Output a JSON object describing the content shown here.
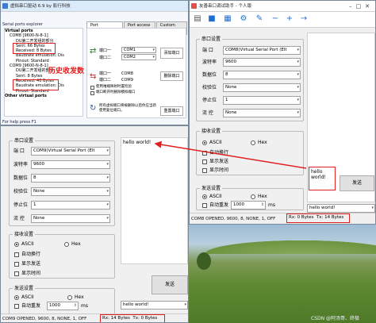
{
  "colors": {
    "accent_red": "#e02020",
    "vspd_title_blue": "#dcebfa",
    "assistant_icon_blue": "#1f6fd1",
    "status_bg": "#f0f0f0",
    "grass_green": "#6f9a3f",
    "sky_blue": "#8fb8d8",
    "callout_bg": "#ffffe0"
  },
  "vspd": {
    "title": "虚拟串口驱动 6.9 by 影行科技",
    "menu": [
      "Port management",
      "Port access list",
      "Custom pinout"
    ],
    "explorer_title": "Serial ports explorer",
    "tree": [
      "Virtual ports",
      "COM8 [9600-N-8-1]",
      "DU第二开发组的部分",
      "Sent: 66 Bytes",
      "Received: 8 Bytes",
      "Baudrate emulation: Dis",
      "Pinout: Standard",
      "COM9 [9600-N-8-1]",
      "DU第二开发组的部分",
      "Sent: 8 Bytes",
      "Received: 40 Bytes",
      "Baudrate emulation: Dis",
      "Pinout: Standard",
      "Other virtual ports"
    ],
    "port1_label": "端口一",
    "port1_value": "COM1",
    "port2_label": "端口二",
    "port2_value": "COM2",
    "add_button": "添加端口",
    "del_port1_label": "端口一",
    "del_port1_value": "COM8",
    "del_port2_label": "端口二",
    "del_port2_value": "COM9",
    "delete_button": "删除端口",
    "chk1": "使用唯端映射时置检验",
    "chk2": "端口断开时删除模拟端口",
    "reset_text": "所有虚拟端口将被删除以后你应当新使用复位端口。",
    "reset_button": "重置端口",
    "status": "For help press F1",
    "annotation": "历史收发数"
  },
  "assistant_top": {
    "title": "友善串口调试助手 - 个人版",
    "settings_title": "串口设置",
    "port_label": "端 口",
    "port_value": "COM8(Virtual Serial Port (Elt",
    "baud_label": "波特率",
    "baud_value": "9600",
    "data_label": "数据位",
    "data_value": "8",
    "parity_label": "校验位",
    "parity_value": "None",
    "stop_label": "停止位",
    "stop_value": "1",
    "flow_label": "流 控",
    "flow_value": "None",
    "rx_title": "接收设置",
    "rx_ascii": "ASCII",
    "rx_hex": "Hex",
    "rx_opts": [
      "自动换行",
      "显示发送",
      "显示时间"
    ],
    "tx_title": "发送设置",
    "tx_ascii": "ASCII",
    "tx_hex": "Hex",
    "repeat_label": "自动重发",
    "repeat_value": "1000",
    "repeat_unit": "ms",
    "callout": "hello\nworld!",
    "send_button": "发送",
    "tx_input": "hello world!",
    "status": "COM8 OPENED, 9600, 8, NONE, 1, OFF",
    "rx_count": "Rx: 0 Bytes",
    "tx_count": "Tx: 14 Bytes"
  },
  "assistant_bottom": {
    "settings_title": "串口设置",
    "port_label": "端 口",
    "port_value": "COM9(Virtual Serial Port (Elt",
    "baud_label": "波特率",
    "baud_value": "9600",
    "data_label": "数据位",
    "data_value": "8",
    "parity_label": "校验位",
    "parity_value": "None",
    "stop_label": "停止位",
    "stop_value": "1",
    "flow_label": "流 控",
    "flow_value": "None",
    "rx_area": "hello world!",
    "rx_title": "接收设置",
    "rx_ascii": "ASCII",
    "rx_hex": "Hex",
    "rx_opts": [
      "自动换行",
      "显示发送",
      "显示时间"
    ],
    "tx_title": "发送设置",
    "tx_ascii": "ASCII",
    "tx_hex": "Hex",
    "repeat_label": "自动重发",
    "repeat_value": "1000",
    "repeat_unit": "ms",
    "send_button": "发送",
    "tx_input": "hello world!",
    "status": "COM9 OPENED, 9600, 8, NONE, 1, OFF",
    "rx_count": "Rx: 14 Bytes",
    "tx_count": "Tx: 0 Bytes"
  },
  "watermark": "CSDN @阿汤哥、终极"
}
